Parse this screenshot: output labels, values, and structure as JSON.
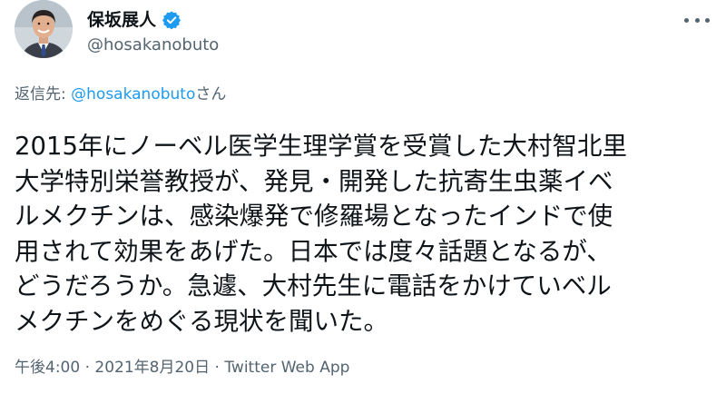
{
  "author": {
    "display_name": "保坂展人",
    "handle": "@hosakanobuto",
    "verified_icon": "verified-badge-icon",
    "avatar": "profile-avatar"
  },
  "colors": {
    "accent": "#1d9bf0",
    "secondary_text": "#536471",
    "primary_text": "#0f1419"
  },
  "reply": {
    "prefix": "返信先: ",
    "target": "@hosakanobuto",
    "suffix": "さん"
  },
  "tweet": {
    "text": "2015年にノーベル医学生理学賞を受賞した大村智北里\n大学特別栄誉教授が、発見・開発した抗寄生虫薬イベ\nルメクチンは、感染爆発で修羅場となったインドで使\n用されて効果をあげた。日本では度々話題となるが、\nどうだろうか。急遽、大村先生に電話をかけていベル\nメクチンをめぐる現状を聞いた。"
  },
  "meta": {
    "time": "午後4:00",
    "separator": " · ",
    "date": "2021年8月20日",
    "source": "Twitter Web App"
  },
  "menu": {
    "icon": "more-options-icon"
  }
}
